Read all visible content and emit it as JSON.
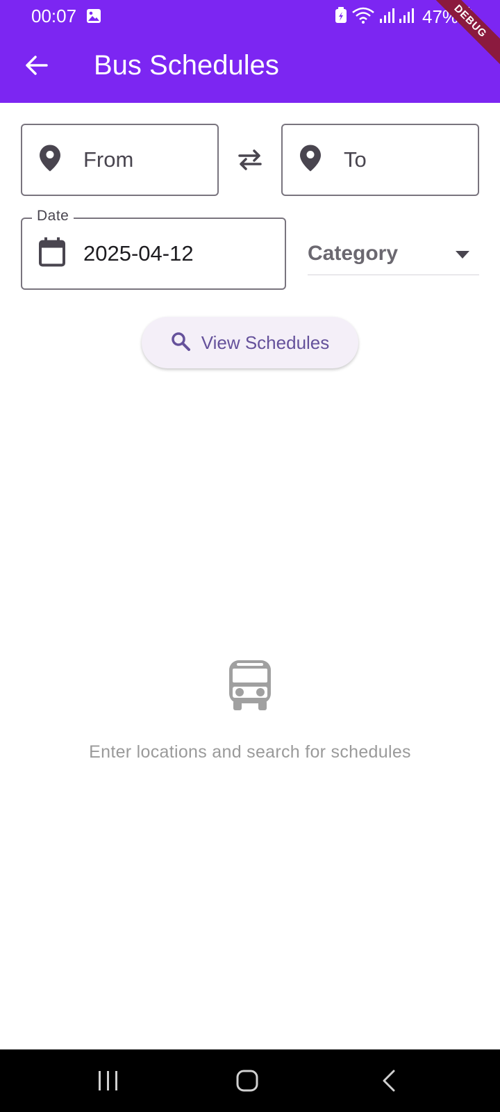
{
  "status_bar": {
    "time": "00:07",
    "battery": "47%"
  },
  "debug_banner": "DEBUG",
  "app_bar": {
    "title": "Bus Schedules",
    "back_icon": "arrow-back-icon"
  },
  "search": {
    "from_label": "From",
    "to_label": "To",
    "date_label": "Date",
    "date_value": "2025-04-12",
    "category_label": "Category",
    "button_label": "View Schedules"
  },
  "empty_state": {
    "icon": "bus-icon",
    "message": "Enter locations and search for schedules"
  },
  "colors": {
    "app_bar": "#7c26f2",
    "button_bg": "#f4eff8",
    "button_text": "#65519b"
  }
}
